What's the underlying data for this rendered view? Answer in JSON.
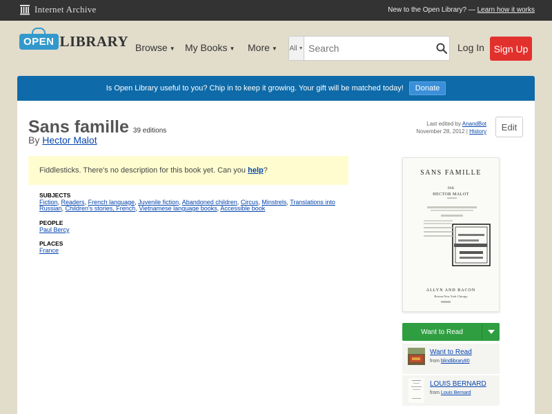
{
  "ia_bar": {
    "name": "Internet Archive",
    "promo_text": "New to the Open Library? —",
    "promo_link": "Learn how it works"
  },
  "header": {
    "logo_open": "OPEN",
    "logo_library": "LIBRARY",
    "nav": [
      {
        "label": "Browse"
      },
      {
        "label": "My Books"
      },
      {
        "label": "More"
      }
    ],
    "search_scope": "All",
    "search_placeholder": "Search",
    "login_label": "Log In",
    "signup_label": "Sign Up"
  },
  "banner": {
    "text": "Is Open Library useful to you? Chip in to keep it growing. Your gift will be matched today!",
    "donate_label": "Donate"
  },
  "book": {
    "title": "Sans famille",
    "editions": "39 editions",
    "by_prefix": "By",
    "author": "Hector Malot",
    "last_edited_prefix": "Last edited by",
    "last_edited_by": "AnandBot",
    "last_edited_date": "November 28, 2012 |",
    "history_label": "History",
    "edit_label": "Edit"
  },
  "description": {
    "text": "Fiddlesticks. There's no description for this book yet. Can you",
    "help_link": "help",
    "suffix": "?"
  },
  "subjects": {
    "heading": "SUBJECTS",
    "items": [
      "Fiction",
      "Readers",
      "French language",
      "Juvenile fiction",
      "Abandoned children",
      "Circus",
      "Minstrels",
      "Translations into Russian",
      "Children's stories, French",
      "Vietnamese language books",
      "Accessible book"
    ]
  },
  "people": {
    "heading": "PEOPLE",
    "items": [
      "Paul Bercy"
    ]
  },
  "places": {
    "heading": "PLACES",
    "items": [
      "France"
    ]
  },
  "cover": {
    "title": "SANS FAMILLE",
    "par": "PAR",
    "author": "HECTOR MALOT",
    "publisher": "ALLYN AND BACON",
    "cities": "Boston    New York    Chicago"
  },
  "want_to_read": {
    "label": "Want to Read"
  },
  "lists": [
    {
      "title": "Want to Read",
      "from_prefix": "from",
      "from": "blindlibrary80"
    },
    {
      "title": "LOUIS BERNARD",
      "from_prefix": "from",
      "from": "Louis Bernard"
    }
  ],
  "colors": {
    "banner": "#0e6aa8",
    "signup": "#e2312d",
    "want_to_read": "#2f9e40",
    "background": "#e2dccb"
  }
}
